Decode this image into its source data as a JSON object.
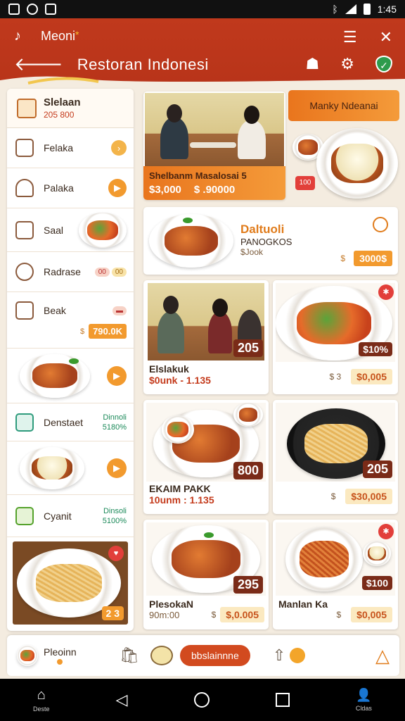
{
  "statusbar": {
    "time": "1:45"
  },
  "header": {
    "app_name": "Meoni",
    "star": "*",
    "title": "Restoran Indonesi"
  },
  "sidebar": {
    "top": {
      "label": "Slelaan",
      "sub": "205 800"
    },
    "items": [
      {
        "label": "Felaka"
      },
      {
        "label": "Palaka"
      },
      {
        "label": "Saal"
      },
      {
        "label": "Radrase",
        "pill1": "00",
        "pill2": "00"
      },
      {
        "label": "Beak",
        "dots": "$",
        "price": "790.0K"
      },
      {
        "label": "Denstaet",
        "green_line1": "Dinnoli",
        "green_line2": "5180%"
      },
      {
        "label": "Cyanit",
        "green_line1": "Dinsoli",
        "green_line2": "5100%"
      }
    ],
    "last_badge": "2 3"
  },
  "cards": {
    "featured": {
      "name": "Shelbanm Masalosai",
      "num": "5",
      "price1": "$3,000",
      "price2": "$ .90000",
      "tag": "100"
    },
    "banner": {
      "label": "Manky Ndeanai"
    },
    "wide": {
      "title": "Daltuoli",
      "subtitle": "PANOGKOS",
      "meta": "$Jook",
      "dots": "$",
      "price": "3000$"
    },
    "c1": {
      "badge": "205",
      "name": "Elslakuk",
      "sub": "$0unk - 1.135"
    },
    "c2": {
      "badge": "$10%",
      "dots": "$ 3",
      "price": "$0,005"
    },
    "c3": {
      "badge": "800",
      "name": "EKAIM PAKK",
      "sub": "10unm : 1.135"
    },
    "c4": {
      "badge": "205",
      "dots": "$",
      "price": "$30,005"
    },
    "c5": {
      "badge": "295",
      "name": "PlesokaN",
      "sub": "90m:00",
      "dots": "$",
      "price": "$,0.005"
    },
    "c6": {
      "badge": "$100",
      "name": "Manlan Ka",
      "dots": "$",
      "price": "$0,005"
    }
  },
  "bottombar": {
    "home_label": "Pleoinn",
    "cta_label": "bbslainnne"
  },
  "navbar": {
    "home": "Deste",
    "account": "Cldas"
  }
}
